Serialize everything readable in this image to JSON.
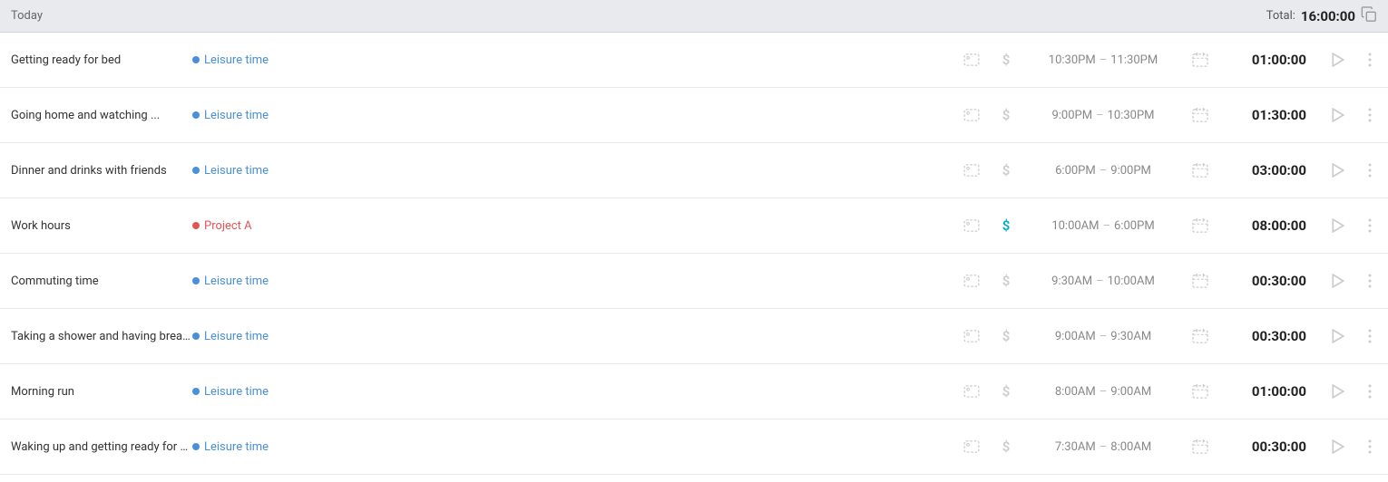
{
  "header": {
    "today_label": "Today",
    "total_label": "Total:",
    "total_time": "16:00:00",
    "copy_icon": "📋"
  },
  "entries": [
    {
      "name": "Getting ready for bed",
      "project": "Leisure time",
      "project_color": "blue",
      "billable_active": false,
      "time_start": "10:30PM",
      "time_end": "11:30PM",
      "duration": "01:00:00"
    },
    {
      "name": "Going home and watching ...",
      "project": "Leisure time",
      "project_color": "blue",
      "billable_active": false,
      "time_start": "9:00PM",
      "time_end": "10:30PM",
      "duration": "01:30:00"
    },
    {
      "name": "Dinner and drinks with friends",
      "project": "Leisure time",
      "project_color": "blue",
      "billable_active": false,
      "time_start": "6:00PM",
      "time_end": "9:00PM",
      "duration": "03:00:00"
    },
    {
      "name": "Work hours",
      "project": "Project A",
      "project_color": "red",
      "billable_active": true,
      "time_start": "10:00AM",
      "time_end": "6:00PM",
      "duration": "08:00:00"
    },
    {
      "name": "Commuting time",
      "project": "Leisure time",
      "project_color": "blue",
      "billable_active": false,
      "time_start": "9:30AM",
      "time_end": "10:00AM",
      "duration": "00:30:00"
    },
    {
      "name": "Taking a shower and having breakfast",
      "project": "Leisure time",
      "project_color": "blue",
      "billable_active": false,
      "time_start": "9:00AM",
      "time_end": "9:30AM",
      "duration": "00:30:00"
    },
    {
      "name": "Morning run",
      "project": "Leisure time",
      "project_color": "blue",
      "billable_active": false,
      "time_start": "8:00AM",
      "time_end": "9:00AM",
      "duration": "01:00:00"
    },
    {
      "name": "Waking up and getting ready for a run",
      "project": "Leisure time",
      "project_color": "blue",
      "billable_active": false,
      "time_start": "7:30AM",
      "time_end": "8:00AM",
      "duration": "00:30:00"
    }
  ]
}
